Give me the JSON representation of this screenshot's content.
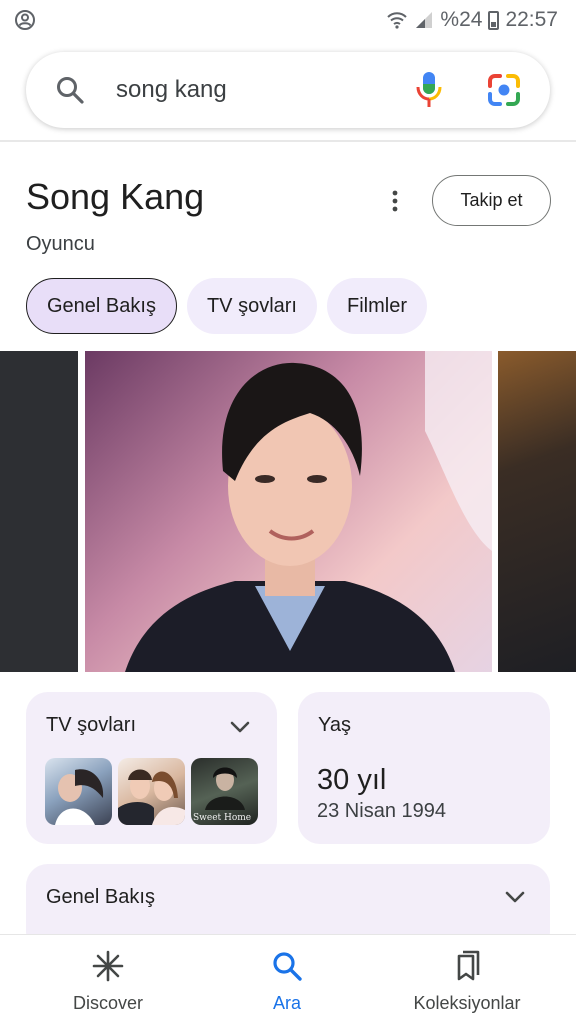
{
  "status_bar": {
    "battery": "%24",
    "time": "22:57",
    "icons": [
      "account-circle-icon",
      "wifi-icon",
      "signal-icon",
      "battery-icon"
    ]
  },
  "search": {
    "query": "song kang",
    "icons": [
      "search-icon",
      "mic-icon",
      "lens-icon"
    ]
  },
  "entity": {
    "title": "Song Kang",
    "subtitle": "Oyuncu",
    "follow_label": "Takip et"
  },
  "tabs": [
    {
      "label": "Genel Bakış",
      "active": true
    },
    {
      "label": "TV şovları",
      "active": false
    },
    {
      "label": "Filmler",
      "active": false
    }
  ],
  "cards": {
    "tv_shows": {
      "title": "TV şovları",
      "thumb_caption": "Sweet Home"
    },
    "age": {
      "title": "Yaş",
      "value": "30 yıl",
      "birth_date": "23 Nisan 1994"
    },
    "overview": {
      "title": "Genel Bakış"
    }
  },
  "bottom_nav": [
    {
      "label": "Discover",
      "icon": "discover-icon",
      "active": false
    },
    {
      "label": "Ara",
      "icon": "search-icon",
      "active": true
    },
    {
      "label": "Koleksiyonlar",
      "icon": "collections-icon",
      "active": false
    }
  ],
  "colors": {
    "accent": "#1a73e8",
    "chip_bg": "#f1ecfb",
    "chip_active_bg": "#e8def8",
    "card_bg": "#f3eef9"
  }
}
